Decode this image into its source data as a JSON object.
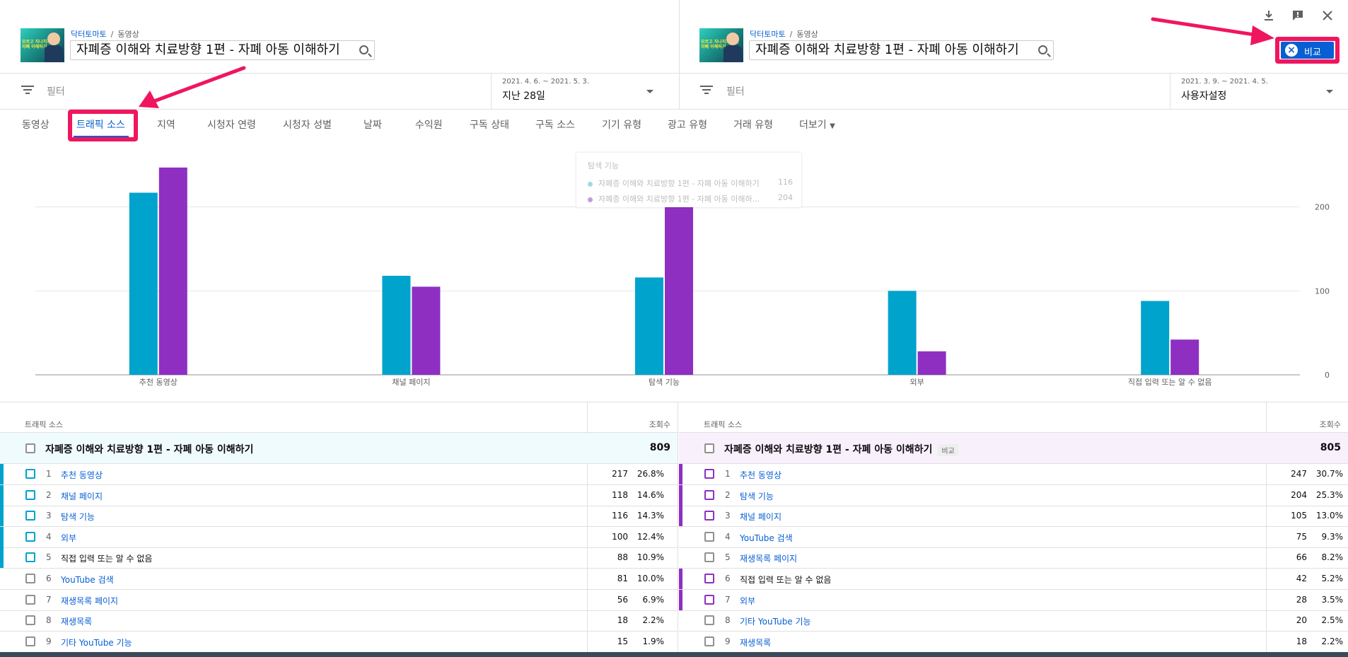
{
  "left_header": {
    "channel": "닥터토마토",
    "section": "동영상",
    "video_title": "자폐증 이해와 치료방향 1편 - 자폐 아동 이해하기",
    "thumb_text": "모르고 지나치기 쉬운 자폐 이해하기",
    "filter_label": "필터",
    "date_range": "2021. 4. 6. ~ 2021. 5. 3.",
    "date_label": "지난 28일"
  },
  "right_header": {
    "channel": "닥터토마토",
    "section": "동영상",
    "video_title": "자폐증 이해와 치료방향 1편 - 자폐 아동 이해하기",
    "thumb_text": "모르고 지나치기 쉬운 자폐 이해하기",
    "filter_label": "필터",
    "date_range": "2021. 3. 9. ~ 2021. 4. 5.",
    "date_label": "사용자설정"
  },
  "toolbar": {
    "download_icon": "download-icon",
    "feedback_icon": "feedback-icon",
    "close_icon": "close-icon",
    "compare_label": "비교"
  },
  "tabs": [
    {
      "label": "동영상"
    },
    {
      "label": "트래픽 소스"
    },
    {
      "label": "지역"
    },
    {
      "label": "시청자 연령"
    },
    {
      "label": "시청자 성별"
    },
    {
      "label": "날짜"
    },
    {
      "label": "수익원"
    },
    {
      "label": "구독 상태"
    },
    {
      "label": "구독 소스"
    },
    {
      "label": "기기 유형"
    },
    {
      "label": "광고 유형"
    },
    {
      "label": "거래 유형"
    },
    {
      "label": "더보기"
    }
  ],
  "active_tab": "트래픽 소스",
  "colors": {
    "series_a": "#00a3cc",
    "series_b": "#8e2fc2",
    "accent": "#065fd4",
    "annotation": "#f0155f"
  },
  "chart_data": {
    "type": "bar",
    "categories": [
      "추천 동영상",
      "채널 페이지",
      "탐색 기능",
      "외부",
      "직접 입력 또는 알 수 없음"
    ],
    "series": [
      {
        "values": [
          217,
          118,
          116,
          100,
          88
        ]
      },
      {
        "values": [
          247,
          105,
          204,
          28,
          42
        ]
      }
    ],
    "ylim": [
      0,
      300
    ],
    "yticks": [
      0,
      100,
      200,
      300
    ],
    "grid": true,
    "tooltip": {
      "title": "탐색 기능",
      "rows": [
        {
          "label": "자폐증 이해와 치료방향 1편 - 자폐 아동 이해하기",
          "value": "116"
        },
        {
          "label": "자폐증 이해와 치료방향 1편 - 자폐 아동 이해하...",
          "value": "204"
        }
      ]
    }
  },
  "table_left": {
    "col_source": "트래픽 소스",
    "col_views": "조회수",
    "total_title": "자폐증 이해와 치료방향 1편 - 자폐 아동 이해하기",
    "total_value": "809",
    "rows": [
      {
        "rank": "1",
        "name": "추천 동영상",
        "link": true,
        "views": "217",
        "pct": "26.8%",
        "sel": true
      },
      {
        "rank": "2",
        "name": "채널 페이지",
        "link": true,
        "views": "118",
        "pct": "14.6%",
        "sel": true
      },
      {
        "rank": "3",
        "name": "탐색 기능",
        "link": true,
        "views": "116",
        "pct": "14.3%",
        "sel": true
      },
      {
        "rank": "4",
        "name": "외부",
        "link": true,
        "views": "100",
        "pct": "12.4%",
        "sel": true
      },
      {
        "rank": "5",
        "name": "직접 입력 또는 알 수 없음",
        "link": false,
        "views": "88",
        "pct": "10.9%",
        "sel": true
      },
      {
        "rank": "6",
        "name": "YouTube 검색",
        "link": true,
        "views": "81",
        "pct": "10.0%",
        "sel": false
      },
      {
        "rank": "7",
        "name": "재생목록 페이지",
        "link": true,
        "views": "56",
        "pct": "6.9%",
        "sel": false
      },
      {
        "rank": "8",
        "name": "재생목록",
        "link": true,
        "views": "18",
        "pct": "2.2%",
        "sel": false
      },
      {
        "rank": "9",
        "name": "기타 YouTube 기능",
        "link": true,
        "views": "15",
        "pct": "1.9%",
        "sel": false
      }
    ]
  },
  "table_right": {
    "col_source": "트래픽 소스",
    "col_views": "조회수",
    "total_title": "자폐증 이해와 치료방향 1편 - 자폐 아동 이해하기",
    "badge": "비교",
    "total_value": "805",
    "rows": [
      {
        "rank": "1",
        "name": "추천 동영상",
        "link": true,
        "views": "247",
        "pct": "30.7%",
        "sel": true
      },
      {
        "rank": "2",
        "name": "탐색 기능",
        "link": true,
        "views": "204",
        "pct": "25.3%",
        "sel": true
      },
      {
        "rank": "3",
        "name": "채널 페이지",
        "link": true,
        "views": "105",
        "pct": "13.0%",
        "sel": true
      },
      {
        "rank": "4",
        "name": "YouTube 검색",
        "link": true,
        "views": "75",
        "pct": "9.3%",
        "sel": false
      },
      {
        "rank": "5",
        "name": "재생목록 페이지",
        "link": true,
        "views": "66",
        "pct": "8.2%",
        "sel": false
      },
      {
        "rank": "6",
        "name": "직접 입력 또는 알 수 없음",
        "link": false,
        "views": "42",
        "pct": "5.2%",
        "sel": true
      },
      {
        "rank": "7",
        "name": "외부",
        "link": true,
        "views": "28",
        "pct": "3.5%",
        "sel": true
      },
      {
        "rank": "8",
        "name": "기타 YouTube 기능",
        "link": true,
        "views": "20",
        "pct": "2.5%",
        "sel": false
      },
      {
        "rank": "9",
        "name": "재생목록",
        "link": true,
        "views": "18",
        "pct": "2.2%",
        "sel": false
      }
    ]
  }
}
